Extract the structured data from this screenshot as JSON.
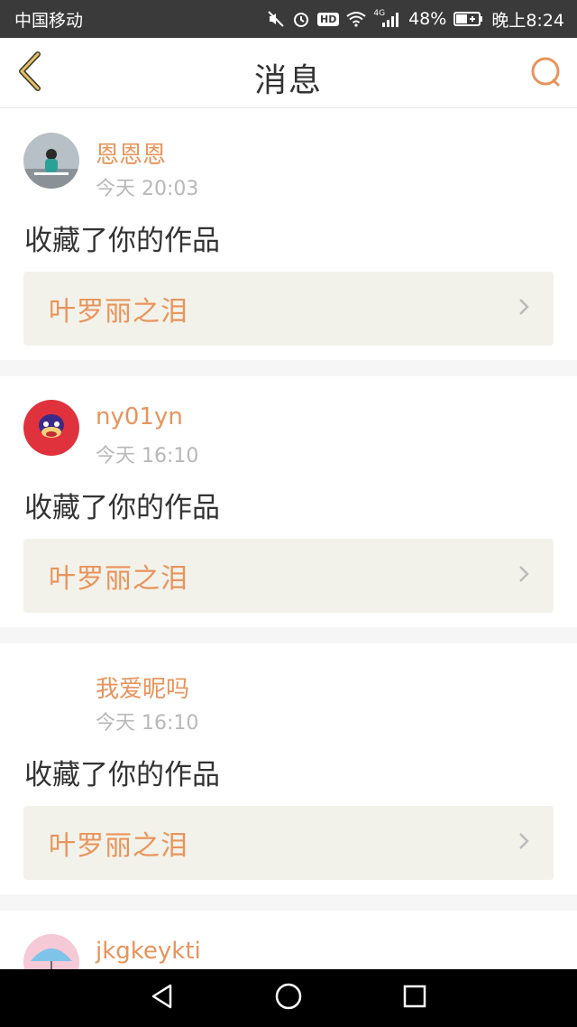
{
  "status_bar": {
    "carrier": "中国移动",
    "network": "4G",
    "battery": "48%",
    "time": "晚上8:24",
    "hd": "HD",
    "icons": [
      "mute-icon",
      "alarm-icon",
      "hd-icon",
      "wifi-icon",
      "signal-icon",
      "battery-icon"
    ]
  },
  "header": {
    "title": "消息",
    "back_icon": "chevron-left-icon",
    "search_icon": "search-icon"
  },
  "theme": {
    "accent": "#e8945c",
    "back_color": "#e6c15a",
    "card_bg": "#f3f2ea"
  },
  "messages": [
    {
      "username": "恩恩恩",
      "time": "今天 20:03",
      "action": "收藏了你的作品",
      "work_title": "叶罗丽之泪"
    },
    {
      "username": "ny01yn",
      "time": "今天 16:10",
      "action": "收藏了你的作品",
      "work_title": "叶罗丽之泪"
    },
    {
      "username": "我爱昵吗",
      "time": "今天 16:10",
      "action": "收藏了你的作品",
      "work_title": "叶罗丽之泪"
    },
    {
      "username": "jkgkeykti"
    }
  ],
  "nav_bar": {
    "icons": [
      "back-triangle-icon",
      "home-circle-icon",
      "recents-square-icon"
    ]
  }
}
